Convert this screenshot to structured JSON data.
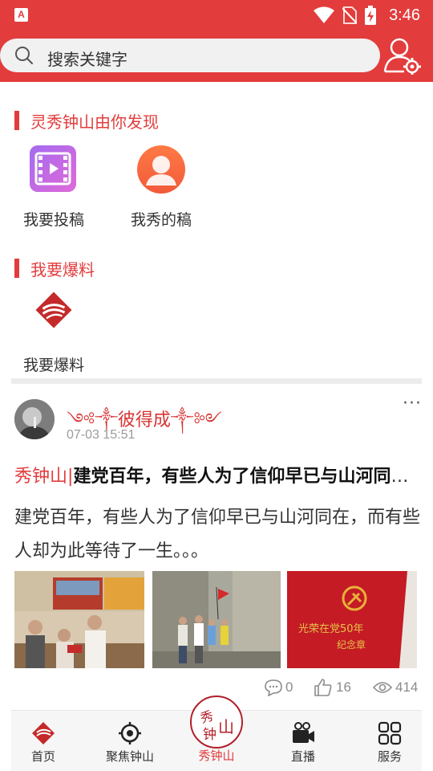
{
  "status_bar": {
    "app_badge": "A",
    "time": "3:46"
  },
  "search": {
    "placeholder": "搜索关键字"
  },
  "discover": {
    "title": "灵秀钟山由你发现",
    "items": [
      {
        "label": "我要投稿",
        "icon": "video-submit-icon"
      },
      {
        "label": "我秀的稿",
        "icon": "my-posts-icon"
      }
    ]
  },
  "report": {
    "title": "我要爆料",
    "items": [
      {
        "label": "我要爆料",
        "icon": "report-logo-icon"
      }
    ]
  },
  "post": {
    "author": "༺༒彼得成༒༻",
    "time": "07-03 15:51",
    "more": "···",
    "tag": "秀钟山",
    "separator": "|",
    "headline": "建党百年，有些人为了信仰早已与山河同在，而有些人却为此等待了一生。。。",
    "summary": "建党百年，有些人为了信仰早已与山河同在，而有些人却为此等待了一生。。。",
    "images": [
      "medal-presentation-photo",
      "street-walk-photo",
      "party-medal-box-photo"
    ],
    "medal_text": {
      "line1": "光荣在党50年",
      "line2": "纪念章"
    },
    "stats": {
      "comments": "0",
      "likes": "16",
      "views": "414"
    }
  },
  "tabbar": {
    "items": [
      {
        "label": "首页",
        "icon": "home-logo-icon"
      },
      {
        "label": "聚焦钟山",
        "icon": "focus-icon"
      },
      {
        "label": "秀钟山",
        "icon": "xiuzhongshan-seal-icon"
      },
      {
        "label": "直播",
        "icon": "live-camera-icon"
      },
      {
        "label": "服务",
        "icon": "services-grid-icon"
      }
    ],
    "center_seal": "秀钟山"
  },
  "colors": {
    "brand_red": "#e23c3c",
    "tab_active": "#e23c3c"
  }
}
